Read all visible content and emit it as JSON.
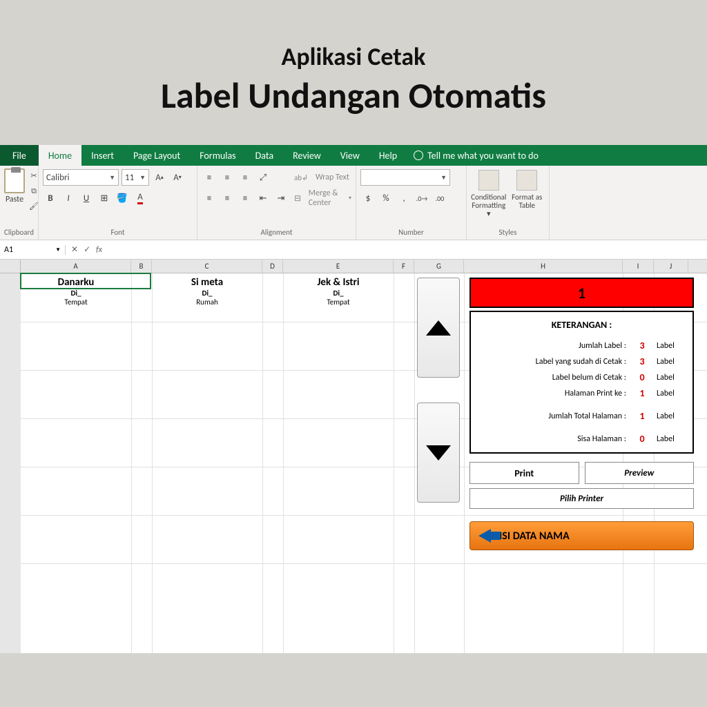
{
  "hero": {
    "subtitle": "Aplikasi Cetak",
    "title": "Label Undangan Otomatis"
  },
  "ribbon": {
    "tabs": [
      "File",
      "Home",
      "Insert",
      "Page Layout",
      "Formulas",
      "Data",
      "Review",
      "View",
      "Help"
    ],
    "active_tab": "Home",
    "tellme": "Tell me what you want to do",
    "groups": {
      "clipboard": {
        "label": "Clipboard",
        "paste": "Paste"
      },
      "font": {
        "label": "Font",
        "name": "Calibri",
        "size": "11"
      },
      "alignment": {
        "label": "Alignment",
        "wrap": "Wrap Text",
        "merge": "Merge & Center"
      },
      "number": {
        "label": "Number",
        "format": "",
        "currency": "$",
        "percent": "%",
        "comma": ","
      },
      "styles": {
        "label": "Styles",
        "cond": "Conditional Formatting",
        "table": "Format as Table"
      }
    }
  },
  "formula_bar": {
    "cell": "A1",
    "fx": "fx"
  },
  "columns": [
    "A",
    "B",
    "C",
    "D",
    "E",
    "F",
    "G",
    "H",
    "I",
    "J"
  ],
  "labels": [
    {
      "name": "Danarku",
      "di": "Di_",
      "tempat": "Tempat"
    },
    {
      "name": "Si meta",
      "di": "Di_",
      "tempat": "Rumah"
    },
    {
      "name": "Jek & Istri",
      "di": "Di_",
      "tempat": "Tempat"
    }
  ],
  "panel": {
    "page": "1",
    "ket_title": "KETERANGAN :",
    "rows": [
      {
        "label": "Jumlah Label :",
        "value": "3",
        "unit": "Label",
        "red": true
      },
      {
        "label": "Label yang sudah di Cetak :",
        "value": "3",
        "unit": "Label",
        "red": true
      },
      {
        "label": "Label belum di Cetak :",
        "value": "0",
        "unit": "Label",
        "red": true
      },
      {
        "label": "Halaman Print ke :",
        "value": "1",
        "unit": "Label",
        "red": true
      },
      {
        "label": "Jumlah Total Halaman :",
        "value": "1",
        "unit": "Label",
        "red": true,
        "gap": true
      },
      {
        "label": "Sisa Halaman :",
        "value": "0",
        "unit": "Label",
        "red": true,
        "gap": true
      }
    ],
    "print": "Print",
    "preview": "Preview",
    "pilih": "Pilih Printer",
    "isi": "ISI DATA NAMA"
  }
}
